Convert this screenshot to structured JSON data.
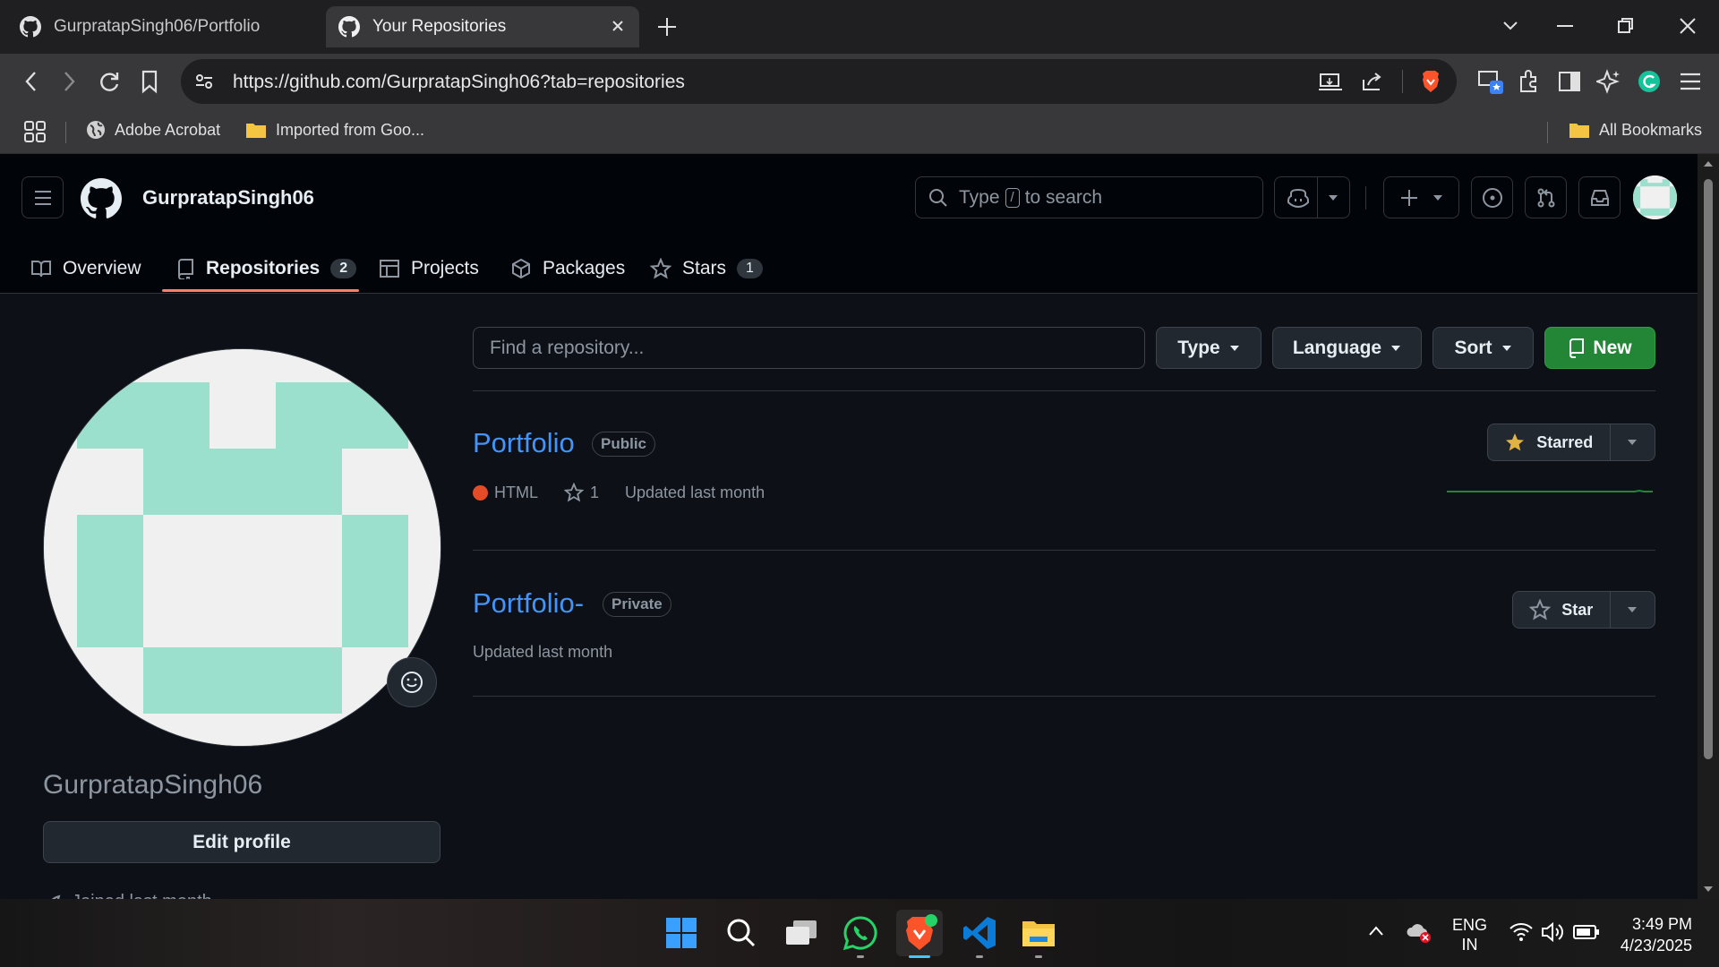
{
  "browser": {
    "tabs": [
      {
        "title": "GurpratapSingh06/Portfolio",
        "active": false
      },
      {
        "title": "Your Repositories",
        "active": true
      }
    ],
    "url": "https://github.com/GurpratapSingh06?tab=repositories",
    "bookmarks": {
      "apps_icon": "apps-grid-icon",
      "items": [
        "Adobe Acrobat",
        "Imported from Goo..."
      ],
      "all": "All Bookmarks"
    }
  },
  "github": {
    "header_username": "GurpratapSingh06",
    "search": {
      "prefix": "Type",
      "key": "/",
      "suffix": "to search"
    },
    "tabs": [
      {
        "label": "Overview",
        "icon": "book-icon"
      },
      {
        "label": "Repositories",
        "icon": "repo-icon",
        "count": "2"
      },
      {
        "label": "Projects",
        "icon": "table-icon"
      },
      {
        "label": "Packages",
        "icon": "package-icon"
      },
      {
        "label": "Stars",
        "icon": "star-icon",
        "count": "1"
      }
    ],
    "profile": {
      "name": "GurpratapSingh06",
      "edit_label": "Edit profile",
      "joined": "Joined last month"
    },
    "filters": {
      "placeholder": "Find a repository...",
      "type": "Type",
      "language": "Language",
      "sort": "Sort",
      "new": "New"
    },
    "repos": [
      {
        "name": "Portfolio",
        "visibility": "Public",
        "language": "HTML",
        "language_color": "#e34c26",
        "stars": "1",
        "updated": "Updated last month",
        "star_label": "Starred",
        "starred": true
      },
      {
        "name": "Portfolio-",
        "visibility": "Private",
        "updated": "Updated last month",
        "star_label": "Star",
        "starred": false
      }
    ]
  },
  "taskbar": {
    "apps": [
      "windows-start-icon",
      "search-icon",
      "task-view-icon",
      "whatsapp-icon",
      "brave-icon",
      "vscode-icon",
      "file-explorer-icon"
    ],
    "lang_top": "ENG",
    "lang_bottom": "IN",
    "time": "3:49 PM",
    "date": "4/23/2025"
  },
  "colors": {
    "accent_green": "#238636",
    "link_blue": "#4493f8",
    "tab_underline": "#f78166",
    "avatar_teal": "#9ae0cc"
  }
}
